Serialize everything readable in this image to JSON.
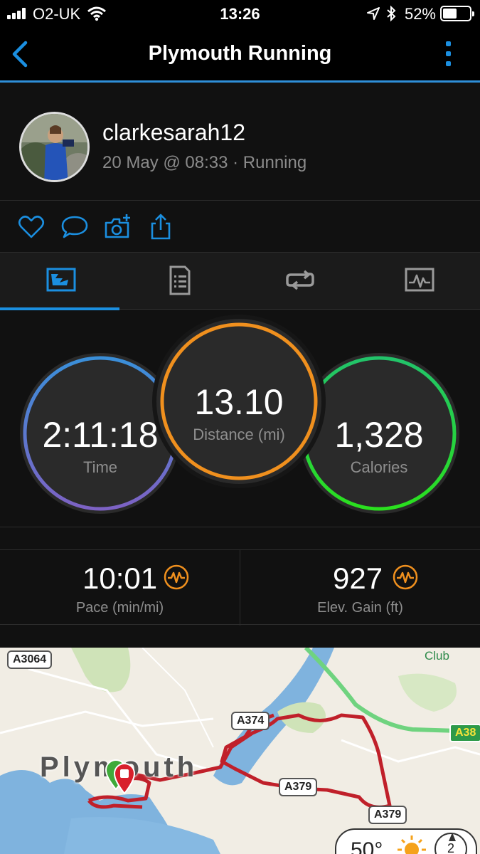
{
  "status_bar": {
    "carrier": "O2-UK",
    "time": "13:26",
    "battery_percent": "52%",
    "battery_level": 0.52,
    "icons": [
      "signal-icon",
      "wifi-icon",
      "location-icon",
      "bluetooth-icon",
      "battery-icon"
    ]
  },
  "nav": {
    "title": "Plymouth Running",
    "back_icon": "chevron-left-icon",
    "more_icon": "more-vertical-icon",
    "accent_color": "#1b8fe0"
  },
  "activity": {
    "username": "clarkesarah12",
    "meta": "20 May @ 08:33 · Running"
  },
  "actions": [
    {
      "icon": "heart-icon"
    },
    {
      "icon": "comment-icon"
    },
    {
      "icon": "add-photo-icon"
    },
    {
      "icon": "share-icon"
    }
  ],
  "tabs": [
    {
      "icon": "map-summary-icon",
      "active": true
    },
    {
      "icon": "details-list-icon",
      "active": false
    },
    {
      "icon": "laps-icon",
      "active": false
    },
    {
      "icon": "charts-icon",
      "active": false
    }
  ],
  "stats": {
    "time": {
      "value": "2:11:18",
      "label": "Time",
      "colors": [
        "#3a8fd9",
        "#7d62c4"
      ]
    },
    "distance": {
      "value": "13.10",
      "label": "Distance (mi)",
      "color": "#f0901e"
    },
    "calories": {
      "value": "1,328",
      "label": "Calories",
      "colors": [
        "#22c36a",
        "#2ae01e"
      ]
    }
  },
  "metrics": {
    "pace": {
      "value": "10:01",
      "label": "Pace (min/mi)",
      "icon": "chart-pulse-icon"
    },
    "elevation": {
      "value": "927",
      "label": "Elev. Gain (ft)",
      "icon": "chart-pulse-icon"
    }
  },
  "map": {
    "place": "Plymouth",
    "roads": [
      "A3064",
      "A374",
      "A379",
      "A379",
      "A38"
    ],
    "poi": "Club",
    "route_color": "#c0202a"
  },
  "weather": {
    "temp": "50°",
    "wind": "2",
    "icon": "sun-icon"
  }
}
